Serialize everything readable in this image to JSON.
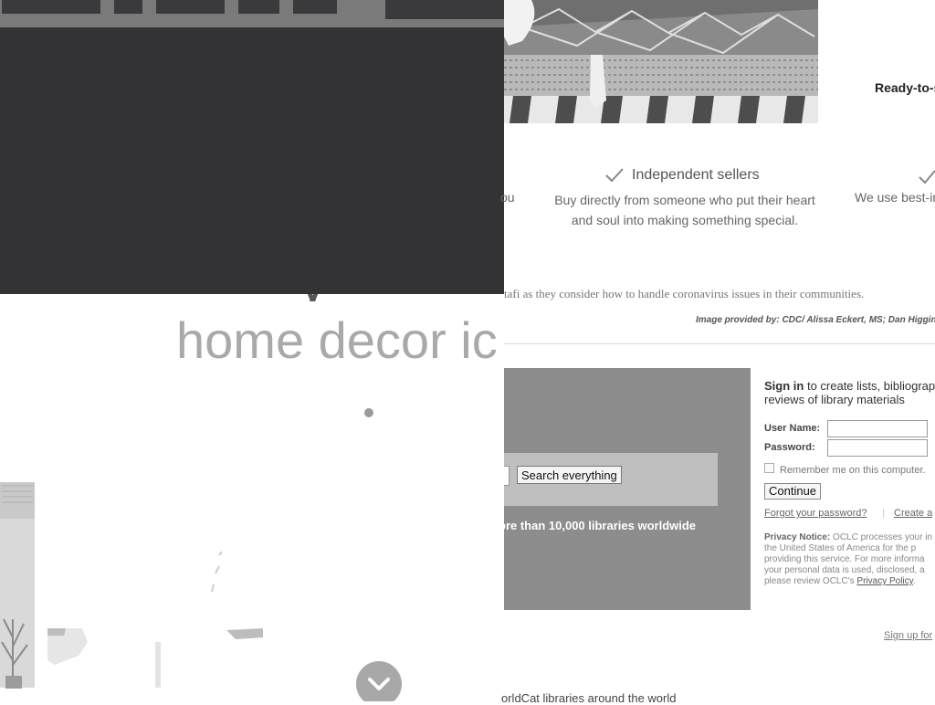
{
  "home": {
    "heading_partial": "y",
    "heading": "home decor ic"
  },
  "colors": {
    "overlay": "#333335",
    "nav_bar": "#7a7a7a",
    "hero_bg": "#8d8d8d"
  },
  "etsy": {
    "ready_text": "Ready-to-s",
    "left_partial": "ou",
    "seller_title": "Independent sellers",
    "seller_desc": "Buy directly from someone who put their heart and soul into making something special.",
    "right_partial": "We use best-ir"
  },
  "article": {
    "caption_body": "tafi as they consider how to handle coronavirus issues in their communities.",
    "caption_credit": "Image provided by: CDC/ Alissa Eckert, MS; Dan Higgin"
  },
  "worldcat": {
    "search_button": "Search everything",
    "tagline": "ore than 10,000 libraries worldwide",
    "signin_link": "Sign in",
    "signin_rest": " to create lists, bibliograp reviews of library materials",
    "username_label": "User Name:",
    "password_label": "Password:",
    "remember_label": "Remember me on this computer.",
    "continue_button": "Continue",
    "forgot_link": "Forgot your password?",
    "separator": "|",
    "create_link": "Create a",
    "privacy_label": "Privacy Notice:",
    "privacy_text": " OCLC processes your in the United States of America for the p providing this service. For more informa your personal data is used, disclosed, a please review OCLC's ",
    "privacy_link": "Privacy Policy",
    "privacy_end": ".",
    "signup_link": "Sign up for",
    "bottom_text": "orldCat libraries around the world"
  },
  "icons": {
    "check": "check-icon",
    "scroll": "chevron-down-icon"
  }
}
